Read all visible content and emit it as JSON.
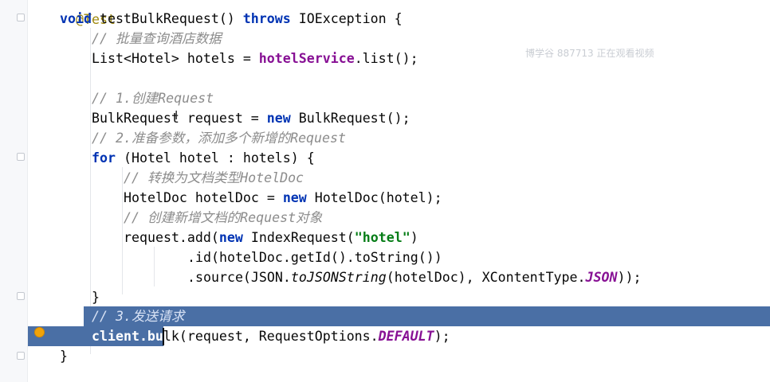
{
  "editor": {
    "watermark": "博学谷 887713 正在观看视频",
    "lines": {
      "l0_annot": "@Test",
      "l1_void": "void",
      "l1_name": " testBulkRequest() ",
      "l1_throws": "throws",
      "l1_exc": " IOException {",
      "l2_comment": "// 批量查询酒店数据",
      "l3_a": "List<Hotel> hotels = ",
      "l3_field": "hotelService",
      "l3_b": ".list();",
      "l5_comment": "// 1.创建Request",
      "l6_a": "BulkRequest request = ",
      "l6_new": "new",
      "l6_b": " BulkRequest();",
      "l7_comment": "// 2.准备参数，添加多个新增的Request",
      "l8_for": "for",
      "l8_b": " (Hotel hotel : hotels) {",
      "l9_comment": "// 转换为文档类型HotelDoc",
      "l10_a": "HotelDoc hotelDoc = ",
      "l10_new": "new",
      "l10_b": " HotelDoc(hotel);",
      "l11_comment": "// 创建新增文档的Request对象",
      "l12_a": "request.add(",
      "l12_new": "new",
      "l12_b": " IndexRequest(",
      "l12_str": "\"hotel\"",
      "l12_c": ")",
      "l13_a": ".id(hotelDoc.getId().toString())",
      "l14_a": ".source(JSON.",
      "l14_static": "toJSONString",
      "l14_b": "(hotelDoc), XContentType.",
      "l14_const": "JSON",
      "l14_c": "));",
      "l15_brace": "}",
      "l16_comment": "// 3.发送请求",
      "l17_a": "client.bulk(request, RequestOptions.",
      "l17_const": "DEFAULT",
      "l17_b": ");",
      "l18_brace": "}"
    }
  }
}
